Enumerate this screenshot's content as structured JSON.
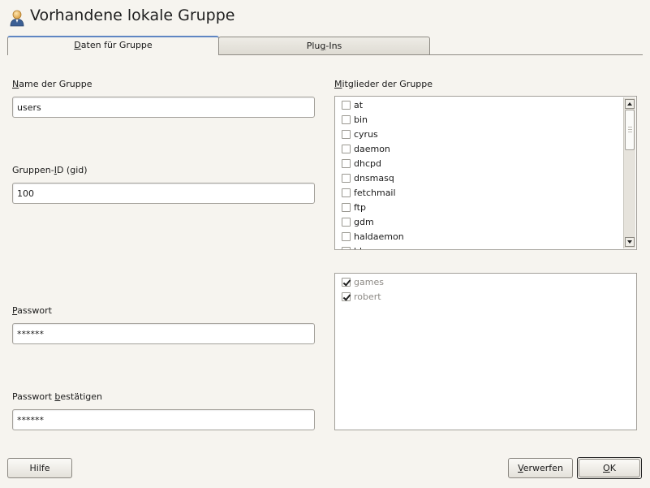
{
  "header": {
    "title": "Vorhandene lokale Gruppe",
    "icon": "group-user-icon"
  },
  "tabs": [
    {
      "label": "Daten für Gruppe",
      "mnemonic": "D",
      "active": true
    },
    {
      "label": "Plug-Ins",
      "mnemonic": "g",
      "active": false
    }
  ],
  "form": {
    "group_name_label": "Name der Gruppe",
    "group_name_value": "users",
    "gid_label": "Gruppen-ID (gid)",
    "gid_value": "100",
    "password_label": "Passwort",
    "password_value": "******",
    "confirm_password_label": "Passwort bestätigen",
    "confirm_password_value": "******"
  },
  "members": {
    "label": "Mitglieder der Gruppe",
    "items": [
      {
        "name": "at",
        "checked": false
      },
      {
        "name": "bin",
        "checked": false
      },
      {
        "name": "cyrus",
        "checked": false
      },
      {
        "name": "daemon",
        "checked": false
      },
      {
        "name": "dhcpd",
        "checked": false
      },
      {
        "name": "dnsmasq",
        "checked": false
      },
      {
        "name": "fetchmail",
        "checked": false
      },
      {
        "name": "ftp",
        "checked": false
      },
      {
        "name": "gdm",
        "checked": false
      },
      {
        "name": "haldaemon",
        "checked": false
      },
      {
        "name": "ldap",
        "checked": false
      }
    ],
    "selected": [
      {
        "name": "games",
        "checked": true
      },
      {
        "name": "robert",
        "checked": true
      }
    ]
  },
  "buttons": {
    "help": "Hilfe",
    "discard": "Verwerfen",
    "ok": "OK"
  },
  "colors": {
    "background": "#f6f4ef",
    "tab_accent": "#5f86c3",
    "dim_text": "#8d8a85"
  }
}
